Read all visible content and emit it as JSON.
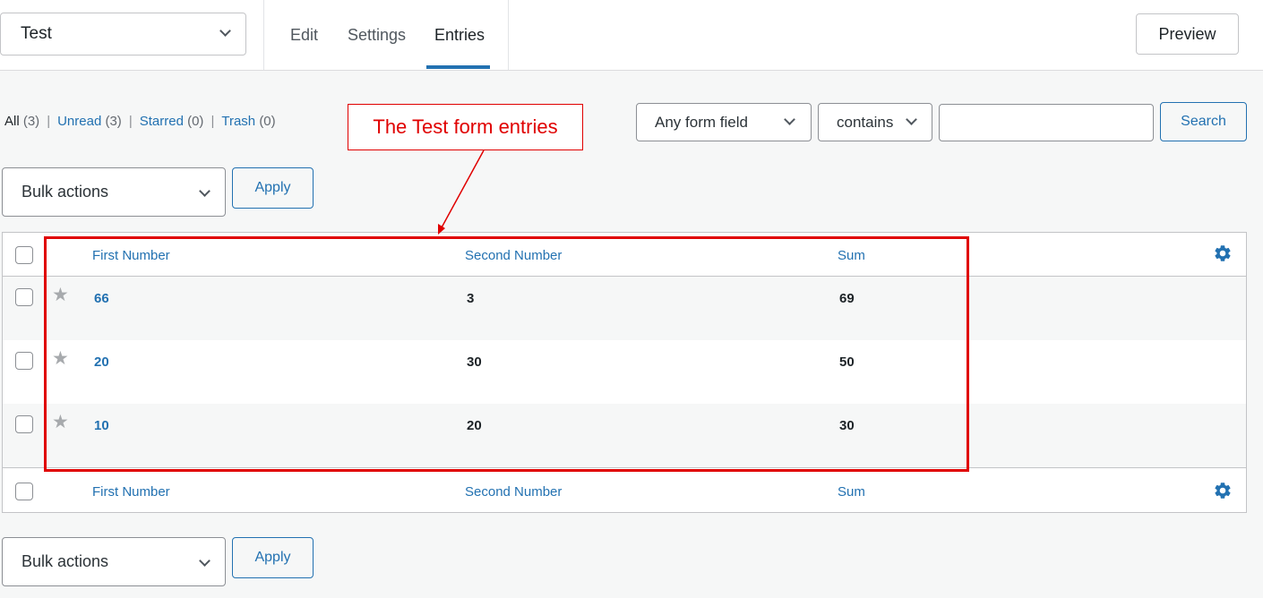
{
  "header": {
    "form_select_value": "Test",
    "tabs": [
      {
        "label": "Edit"
      },
      {
        "label": "Settings"
      },
      {
        "label": "Entries"
      }
    ],
    "preview_label": "Preview"
  },
  "filters": {
    "all_label": "All",
    "all_count": "(3)",
    "unread_label": "Unread",
    "unread_count": "(3)",
    "starred_label": "Starred",
    "starred_count": "(0)",
    "trash_label": "Trash",
    "trash_count": "(0)",
    "separator": "|"
  },
  "search": {
    "field_select": "Any form field",
    "operator_select": "contains",
    "value": "",
    "button_label": "Search"
  },
  "bulk_top": {
    "select_label": "Bulk actions",
    "apply_label": "Apply"
  },
  "bulk_bottom": {
    "select_label": "Bulk actions",
    "apply_label": "Apply"
  },
  "table": {
    "columns": [
      "First Number",
      "Second Number",
      "Sum"
    ],
    "rows": [
      {
        "first": "66",
        "second": "3",
        "sum": "69"
      },
      {
        "first": "20",
        "second": "30",
        "sum": "50"
      },
      {
        "first": "10",
        "second": "20",
        "sum": "30"
      }
    ]
  },
  "annotation": {
    "label": "The Test form entries"
  },
  "colors": {
    "accent": "#2271b1",
    "annotation_red": "#e00000",
    "star_gray": "#a7aaad"
  },
  "icons": {
    "chevron": "chevron-down-icon",
    "star": "star-icon",
    "gear": "gear-icon"
  }
}
